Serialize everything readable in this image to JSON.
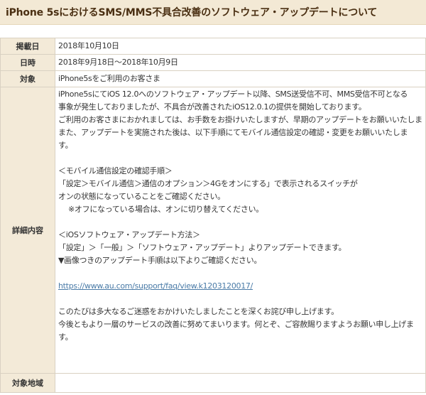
{
  "page": {
    "title": "iPhone 5sにおけるSMS/MMS不具合改善のソフトウェア・アップデートについて"
  },
  "rows": {
    "posted": {
      "label": "掲載日",
      "value": "2018年10月10日"
    },
    "datetime": {
      "label": "日時",
      "value": "2018年9月18日～2018年10月9日"
    },
    "target": {
      "label": "対象",
      "value": "iPhone5sをご利用のお客さま"
    },
    "detail": {
      "label": "詳細内容",
      "lines": [
        "iPhone5sにてiOS 12.0へのソフトウェア・アップデート以降、SMS送受信不可、MMS受信不可となる",
        "事象が発生しておりましたが、不具合が改善されたiOS12.0.1の提供を開始しております。",
        "ご利用のお客さまにおかれましては、お手数をお掛けいたしますが、早期のアップデートをお願いいたしま",
        "また、アップデートを実施された後は、以下手順にてモバイル通信設定の確認・変更をお願いいたしま",
        "す。",
        "",
        "＜モバイル通信設定の確認手順＞",
        "「設定＞モバイル通信＞通信のオプション＞4Gをオンにする」で表示されるスイッチが",
        "オンの状態になっていることをご確認ください。",
        "※オフになっている場合は、オンに切り替えてください。",
        "",
        "＜iOSソフトウェア・アップデート方法＞",
        "「設定」＞「一般」＞「ソフトウェア・アップデート」よりアップデートできます。",
        "▼画像つきのアップデート手順は以下よりご確認ください。",
        "",
        "https://www.au.com/support/faq/view.k1203120017/",
        "",
        "このたびは多大なるご迷惑をおかけいたしましたことを深くお詫び申し上げます。",
        "今後ともより一層のサービスの改善に努めてまいります。何とぞ、ご容赦賜りますようお願い申し上げま",
        "す。"
      ]
    },
    "area": {
      "label": "対象地域",
      "value": ""
    }
  }
}
